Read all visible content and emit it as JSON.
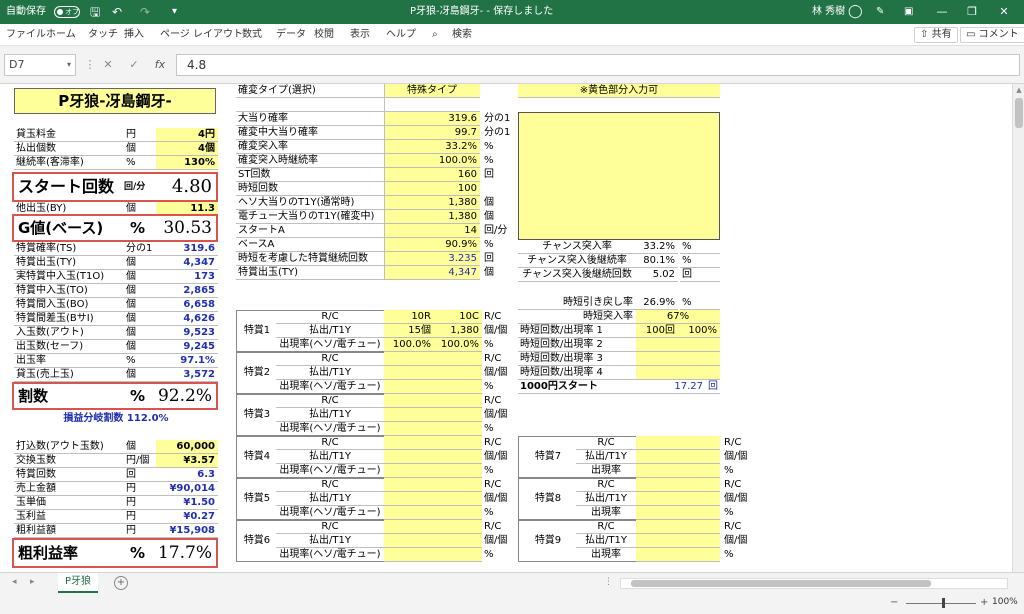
{
  "window": {
    "autosave_label": "自動保存",
    "autosave_state": "オフ",
    "title": "P牙狼-冴島鋼牙-  -  保存しました",
    "user": "林 秀樹"
  },
  "ribbon": {
    "tabs": [
      "ファイル",
      "ホーム",
      "タッチ",
      "挿入",
      "ページ レイアウト",
      "数式",
      "データ",
      "校閲",
      "表示",
      "ヘルプ"
    ],
    "search": "検索",
    "share": "共有",
    "comment": "コメント"
  },
  "formula_bar": {
    "name_box": "D7",
    "value": "4.8"
  },
  "sheet": {
    "title": "P牙狼-冴島鋼牙-",
    "left_top": [
      {
        "label": "貸玉料金",
        "unit": "円",
        "value": "4円"
      },
      {
        "label": "払出個数",
        "unit": "個",
        "value": "4個"
      },
      {
        "label": "継続率(客滞率)",
        "unit": "%",
        "value": "130%"
      }
    ],
    "start": {
      "label": "スタート回数",
      "unit": "回/分",
      "value": "4.80"
    },
    "other_out": {
      "label": "他出玉(BY)",
      "unit": "個",
      "value": "11.3"
    },
    "gvalue": {
      "label": "G値(ベース)",
      "unit": "%",
      "value": "30.53"
    },
    "left_mid": [
      {
        "label": "特賞確率(TS)",
        "unit": "分の1",
        "value": "319.6"
      },
      {
        "label": "特賞出玉(TY)",
        "unit": "個",
        "value": "4,347"
      },
      {
        "label": "実特賞中入玉(T1O)",
        "unit": "個",
        "value": "173"
      },
      {
        "label": "特賞中入玉(TO)",
        "unit": "個",
        "value": "2,865"
      },
      {
        "label": "特賞間入玉(BO)",
        "unit": "個",
        "value": "6,658"
      },
      {
        "label": "特賞間差玉(BサI)",
        "unit": "個",
        "value": "4,626"
      },
      {
        "label": "入玉数(アウト)",
        "unit": "個",
        "value": "9,523"
      },
      {
        "label": "出玉数(セーフ)",
        "unit": "個",
        "value": "9,245"
      },
      {
        "label": "出玉率",
        "unit": "%",
        "value": "97.1%"
      },
      {
        "label": "貸玉(売上玉)",
        "unit": "個",
        "value": "3,572"
      }
    ],
    "wari": {
      "label": "割数",
      "unit": "%",
      "value": "92.2%"
    },
    "breakeven": "損益分岐割数 112.0%",
    "left_bottom": [
      {
        "label": "打込数(アウト玉数)",
        "unit": "個",
        "value": "60,000"
      },
      {
        "label": "交換玉数",
        "unit": "円/個",
        "value": "¥3.57"
      },
      {
        "label": "特賞回数",
        "unit": "回",
        "value": "6.3"
      },
      {
        "label": "売上金額",
        "unit": "円",
        "value": "¥90,014"
      },
      {
        "label": "玉単価",
        "unit": "円",
        "value": "¥1.50"
      },
      {
        "label": "玉利益",
        "unit": "円",
        "value": "¥0.27"
      },
      {
        "label": "粗利益額",
        "unit": "円",
        "value": "¥15,908"
      }
    ],
    "profit_rate": {
      "label": "粗利益率",
      "unit": "%",
      "value": "17.7%"
    },
    "mid_top": {
      "label": "確変タイプ(選択)",
      "value": "特殊タイプ"
    },
    "mid_rows": [
      {
        "label": "大当り確率",
        "value": "319.6",
        "unit": "分の1"
      },
      {
        "label": "確変中大当り確率",
        "value": "99.7",
        "unit": "分の1"
      },
      {
        "label": "確変突入率",
        "value": "33.2%",
        "unit": "%"
      },
      {
        "label": "確変突入時継続率",
        "value": "100.0%",
        "unit": "%"
      },
      {
        "label": "ST回数",
        "value": "160",
        "unit": "回"
      },
      {
        "label": "時短回数",
        "value": "100",
        "unit": ""
      },
      {
        "label": "ヘソ大当りのT1Y(通常時)",
        "value": "1,380",
        "unit": "個"
      },
      {
        "label": "電チュー大当りのT1Y(確変中)",
        "value": "1,380",
        "unit": "個"
      },
      {
        "label": "スタートA",
        "value": "14",
        "unit": "回/分"
      },
      {
        "label": "ベースA",
        "value": "90.9%",
        "unit": "%"
      },
      {
        "label": "時短を考慮した特賞継続回数",
        "value": "3.235",
        "unit": "回"
      },
      {
        "label": "特賞出玉(TY)",
        "value": "4,347",
        "unit": "個"
      }
    ],
    "right_note": "※黄色部分入力可",
    "chance": [
      {
        "label": "チャンス突入率",
        "value": "33.2%",
        "unit": "%"
      },
      {
        "label": "チャンス突入後継続率",
        "value": "80.1%",
        "unit": "%"
      },
      {
        "label": "チャンス突入後継続回数",
        "value": "5.02",
        "unit": "回"
      }
    ],
    "jitan_back": {
      "label": "時短引き戻し率",
      "value": "26.9%",
      "unit": "%"
    },
    "jitan_entry": {
      "label": "時短突入率",
      "value": "67%"
    },
    "jitan_rows": [
      {
        "label": "時短回数/出現率 1",
        "v1": "100回",
        "v2": "100%"
      },
      {
        "label": "時短回数/出現率 2",
        "v1": "",
        "v2": ""
      },
      {
        "label": "時短回数/出現率 3",
        "v1": "",
        "v2": ""
      },
      {
        "label": "時短回数/出現率 4",
        "v1": "",
        "v2": ""
      }
    ],
    "start1000": {
      "label": "1000円スタート",
      "value": "17.27",
      "unit": "回"
    },
    "tokusho_sub": {
      "rc": "R/C",
      "out": "払出/T1Y",
      "rate": "出現率(ヘソ/電チュー)",
      "rate_short": "出現率"
    },
    "tokusho_units": {
      "rc": "R/C",
      "out": "個/個",
      "rate": "%"
    },
    "tokusho": [
      {
        "name": "特賞1",
        "rc1": "10R",
        "rc2": "10C",
        "out1": "15個",
        "out2": "1,380",
        "rate1": "100.0%",
        "rate2": "100.0%"
      },
      {
        "name": "特賞2"
      },
      {
        "name": "特賞3"
      },
      {
        "name": "特賞4"
      },
      {
        "name": "特賞5"
      },
      {
        "name": "特賞6"
      }
    ],
    "tokusho_right": [
      {
        "name": "特賞7"
      },
      {
        "name": "特賞8"
      },
      {
        "name": "特賞9"
      }
    ]
  },
  "sheet_tab": "P牙狼",
  "status": {
    "zoom": "100%"
  }
}
